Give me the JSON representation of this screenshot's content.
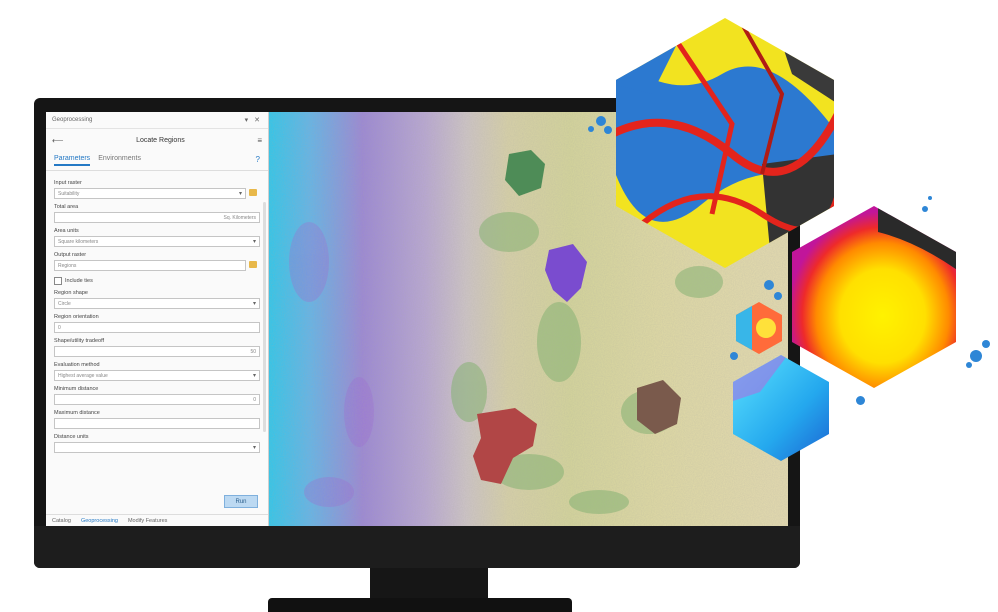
{
  "window": {
    "title": "Geoprocessing",
    "controls": "▾ ✕",
    "tool_title": "Locate Regions"
  },
  "tabs": [
    "Parameters",
    "Environments"
  ],
  "params": [
    {
      "label": "Input raster",
      "value": "Suitability",
      "type": "dd"
    },
    {
      "label": "Total area",
      "value": "Sq. Kilometers",
      "type": "text"
    },
    {
      "label": "Area units",
      "value": "Square kilometers",
      "type": "dd"
    },
    {
      "label": "Output raster",
      "value": "Regions",
      "type": "text"
    }
  ],
  "checkbox": {
    "label": "Include ties"
  },
  "params2": [
    {
      "label": "Region shape",
      "value": "Circle",
      "type": "dd"
    },
    {
      "label": "Region orientation",
      "value": "0",
      "type": "text"
    },
    {
      "label": "Shape/utility tradeoff",
      "value": "50",
      "type": "text"
    },
    {
      "label": "Evaluation method",
      "value": "Highest average value",
      "type": "dd"
    },
    {
      "label": "Minimum distance",
      "value": "0",
      "type": "text"
    },
    {
      "label": "Maximum distance",
      "value": "",
      "type": "text"
    },
    {
      "label": "Distance units",
      "value": "",
      "type": "dd"
    }
  ],
  "run_label": "Run",
  "footer_tabs": [
    "Catalog",
    "Geoprocessing",
    "Modify Features"
  ],
  "colors": {
    "accent": "#2479c5",
    "region_green": "#4e8c57",
    "region_purple": "#7a4ccf",
    "region_brown": "#7a5a4c",
    "region_red": "#b14646"
  }
}
